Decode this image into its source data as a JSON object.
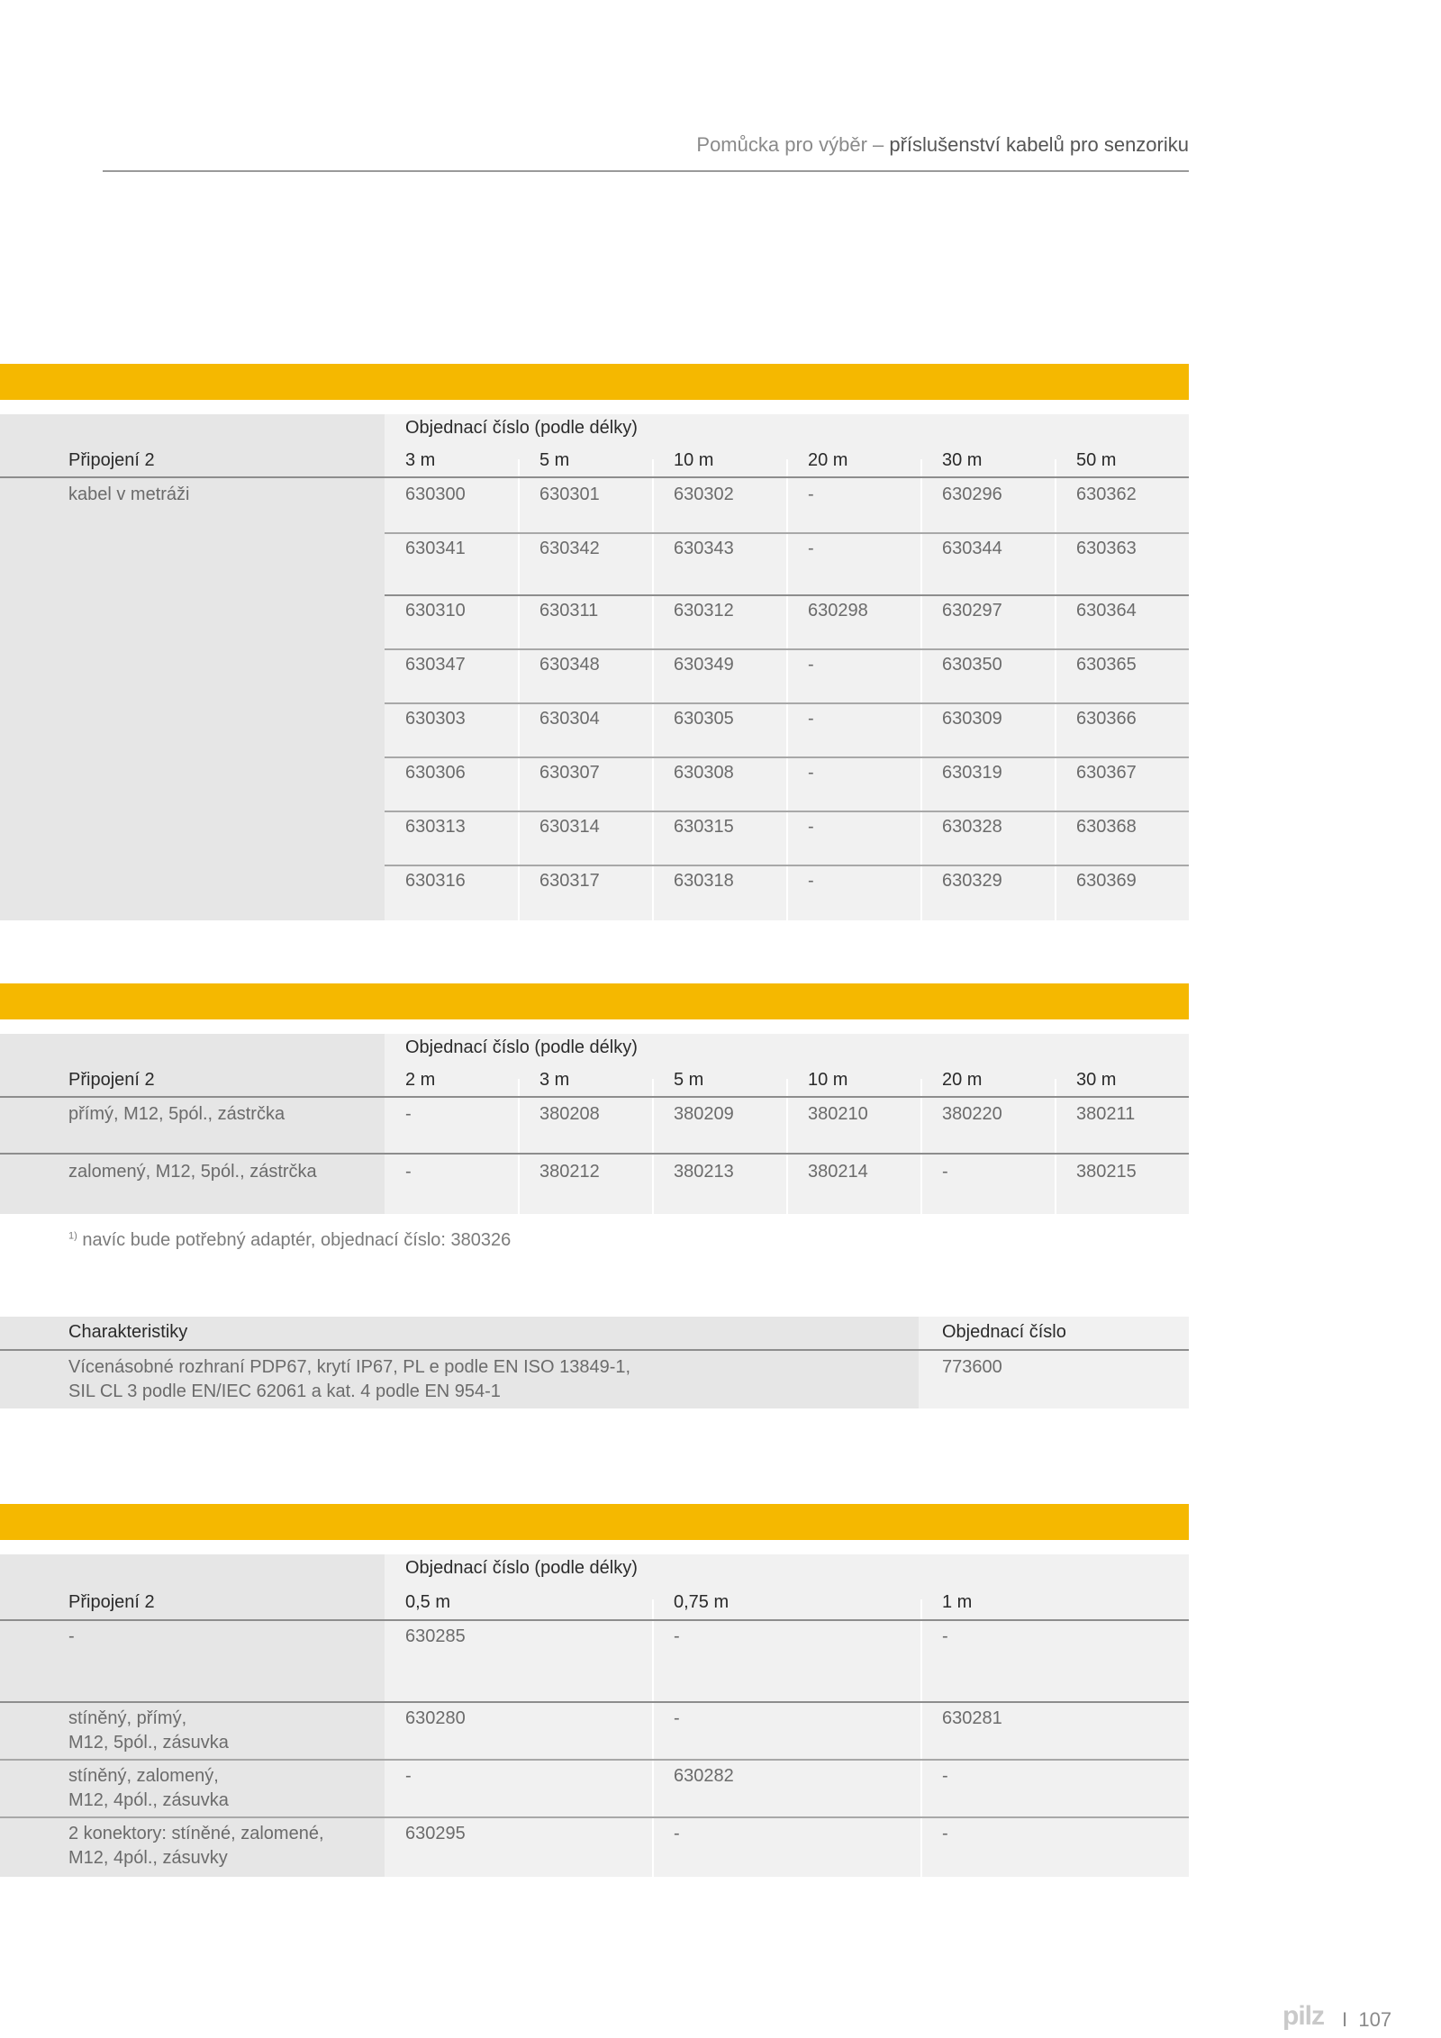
{
  "header": {
    "title_light": "Pomůcka pro výběr – ",
    "title_dark": "příslušenství kabelů pro senzoriku"
  },
  "table1": {
    "group_label": "Objednací číslo (podle délky)",
    "row_label_header": "Připojení 2",
    "columns": [
      "3 m",
      "5 m",
      "10 m",
      "20 m",
      "30 m",
      "50 m"
    ],
    "row_labels": [
      "kabel v metráži"
    ],
    "rows": [
      [
        "630300",
        "630301",
        "630302",
        "-",
        "630296",
        "630362"
      ],
      [
        "630341",
        "630342",
        "630343",
        "-",
        "630344",
        "630363"
      ],
      [
        "630310",
        "630311",
        "630312",
        "630298",
        "630297",
        "630364"
      ],
      [
        "630347",
        "630348",
        "630349",
        "-",
        "630350",
        "630365"
      ],
      [
        "630303",
        "630304",
        "630305",
        "-",
        "630309",
        "630366"
      ],
      [
        "630306",
        "630307",
        "630308",
        "-",
        "630319",
        "630367"
      ],
      [
        "630313",
        "630314",
        "630315",
        "-",
        "630328",
        "630368"
      ],
      [
        "630316",
        "630317",
        "630318",
        "-",
        "630329",
        "630369"
      ]
    ]
  },
  "table2": {
    "group_label": "Objednací číslo (podle délky)",
    "row_label_header": "Připojení 2",
    "columns": [
      "2 m",
      "3 m",
      "5 m",
      "10 m",
      "20 m",
      "30 m"
    ],
    "row_labels": [
      "přímý, M12, 5pól., zástrčka",
      "zalomený, M12, 5pól., zástrčka"
    ],
    "rows": [
      [
        "-",
        "380208",
        "380209",
        "380210",
        "380220",
        "380211"
      ],
      [
        "-",
        "380212",
        "380213",
        "380214",
        "-",
        "380215"
      ]
    ],
    "footnote_mark": "1)",
    "footnote": " navíc bude potřebný adaptér, objednací číslo: 380326"
  },
  "table3": {
    "header_left": "Charakteristiky",
    "header_right": "Objednací číslo",
    "desc_line1": "Vícenásobné rozhraní PDP67, krytí IP67, PL e podle EN ISO 13849-1,",
    "desc_line2": "SIL CL 3 podle EN/IEC 62061 a kat. 4 podle EN 954-1",
    "order_no": "773600"
  },
  "table4": {
    "group_label": "Objednací číslo (podle délky)",
    "row_label_header": "Připojení 2",
    "columns": [
      "0,5 m",
      "0,75 m",
      "1 m"
    ],
    "rows": [
      {
        "label1": "-",
        "label2": "",
        "values": [
          "630285",
          "-",
          "-"
        ]
      },
      {
        "label1": "stíněný, přímý,",
        "label2": "M12, 5pól., zásuvka",
        "values": [
          "630280",
          "-",
          "630281"
        ]
      },
      {
        "label1": "stíněný, zalomený,",
        "label2": "M12, 4pól., zásuvka",
        "values": [
          "-",
          "630282",
          "-"
        ]
      },
      {
        "label1": "2 konektory: stíněné, zalomené,",
        "label2": "M12, 4pól., zásuvky",
        "values": [
          "630295",
          "-",
          "-"
        ]
      }
    ]
  },
  "footer": {
    "logo": "pilz",
    "separator": "I",
    "page_number": "107"
  },
  "colors": {
    "accent_bar": "#f5b800",
    "label_column": "#e6e6e6",
    "data_column": "#f1f1f1",
    "rule": "#8d8d8d"
  }
}
